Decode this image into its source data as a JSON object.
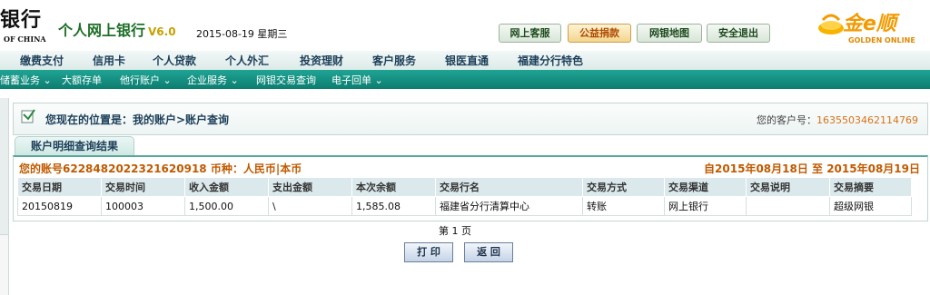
{
  "header": {
    "bank_name": "银行",
    "bank_sub": "OF CHINA",
    "system_title": "个人网上银行",
    "version": "V6.0",
    "date_text": "2015-08-19 星期三",
    "top_buttons": [
      {
        "label": "网上客服"
      },
      {
        "label": "公益捐款"
      },
      {
        "label": "网银地图"
      },
      {
        "label": "安全退出"
      }
    ],
    "brand_cn": "金e顺",
    "brand_en": "GOLDEN ONLINE",
    "brand_color": "#f39a00"
  },
  "nav_main": [
    "缴费支付",
    "信用卡",
    "个人贷款",
    "个人外汇",
    "投资理财",
    "客户服务",
    "银医直通",
    "福建分行特色"
  ],
  "nav_sub": [
    "储蓄业务 ⌄",
    "大额存单",
    "他行账户 ⌄",
    "企业服务 ⌄",
    "网银交易查询",
    "电子回单 ⌄"
  ],
  "location": {
    "text": "您现在的位置是：我的账户>账户查询",
    "customer_label": "您的客户号：",
    "customer_no": "1635503462114769"
  },
  "tab_label": "账户明细查询结果",
  "account_line": "您的账号6228482022321620918 币种：人民币|本币",
  "date_range": "自2015年08月18日  至  2015年08月19日",
  "table": {
    "headers": [
      "交易日期",
      "交易时间",
      "收入金额",
      "支出金额",
      "本次余额",
      "交易行名",
      "交易方式",
      "交易渠道",
      "交易说明",
      "交易摘要"
    ],
    "rows": [
      [
        "20150819",
        "100003",
        "1,500.00",
        "\\",
        "1,585.08",
        "福建省分行清算中心",
        "转账",
        "网上银行",
        "",
        "超级网银"
      ]
    ]
  },
  "page_text": "第 1 页",
  "actions": {
    "print_label": "打 印",
    "back_label": "返 回"
  },
  "colors": {
    "accent_teal": "#0c7d70",
    "highlight_orange": "#c05a00"
  }
}
